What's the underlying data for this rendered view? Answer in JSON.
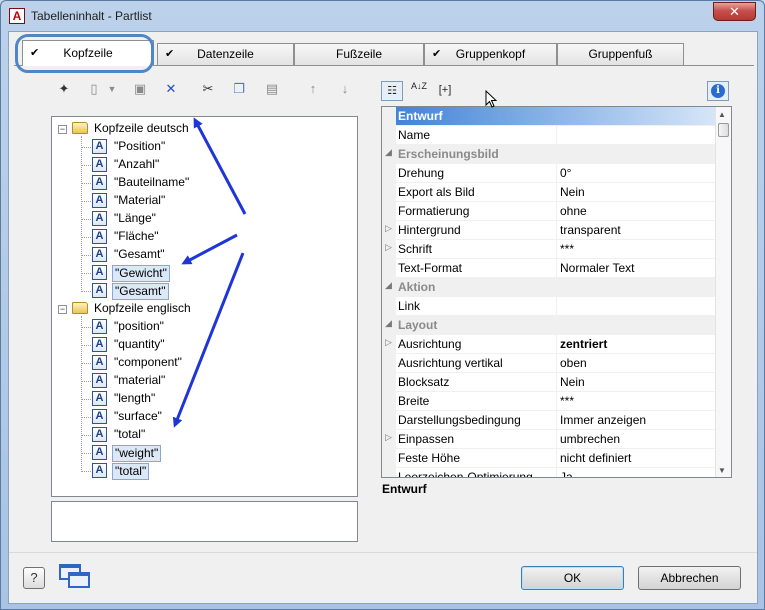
{
  "window": {
    "title": "Tabelleninhalt - Partlist",
    "app_icon_letter": "A",
    "close_glyph": "✕"
  },
  "tabs": [
    {
      "label": "Kopfzeile",
      "checked": true,
      "active": true
    },
    {
      "label": "Datenzeile",
      "checked": true,
      "active": false
    },
    {
      "label": "Fußzeile",
      "checked": false,
      "active": false
    },
    {
      "label": "Gruppenkopf",
      "checked": true,
      "active": false
    },
    {
      "label": "Gruppenfuß",
      "checked": false,
      "active": false
    }
  ],
  "check_glyph": "✔",
  "toolbar_icons": [
    "wand-icon",
    "clipboard-icon",
    "properties-icon",
    "delete-icon",
    "cut-icon",
    "copy-icon",
    "paste-icon",
    "arrow-up-icon",
    "arrow-down-icon"
  ],
  "tree": {
    "groups": [
      {
        "label": "Kopfzeile deutsch",
        "items": [
          {
            "label": "\"Position\"",
            "selected": false
          },
          {
            "label": "\"Anzahl\"",
            "selected": false
          },
          {
            "label": "\"Bauteilname\"",
            "selected": false
          },
          {
            "label": "\"Material\"",
            "selected": false
          },
          {
            "label": "\"Länge\"",
            "selected": false
          },
          {
            "label": "\"Fläche\"",
            "selected": false
          },
          {
            "label": "\"Gesamt\"",
            "selected": false
          },
          {
            "label": "\"Gewicht\"",
            "selected": true
          },
          {
            "label": "\"Gesamt\"",
            "selected": true
          }
        ]
      },
      {
        "label": "Kopfzeile englisch",
        "items": [
          {
            "label": "\"position\"",
            "selected": false
          },
          {
            "label": "\"quantity\"",
            "selected": false
          },
          {
            "label": "\"component\"",
            "selected": false
          },
          {
            "label": "\"material\"",
            "selected": false
          },
          {
            "label": "\"length\"",
            "selected": false
          },
          {
            "label": "\"surface\"",
            "selected": false
          },
          {
            "label": "\"total\"",
            "selected": false
          },
          {
            "label": "\"weight\"",
            "selected": true
          },
          {
            "label": "\"total\"",
            "selected": true
          }
        ]
      }
    ],
    "text_icon_letter": "A"
  },
  "property_toolbar": {
    "categorized_icon": "categorized-icon",
    "sort_label": "A↓Z",
    "expand_label": "[+]",
    "info_glyph": "i"
  },
  "properties": [
    {
      "type": "cat",
      "name": "Entwurf",
      "highlight": true
    },
    {
      "type": "prop",
      "name": "Name",
      "value": ""
    },
    {
      "type": "cat",
      "name": "Erscheinungsbild"
    },
    {
      "type": "prop",
      "name": "Drehung",
      "value": "0°"
    },
    {
      "type": "prop",
      "name": "Export als Bild",
      "value": "Nein"
    },
    {
      "type": "prop",
      "name": "Formatierung",
      "value": "ohne"
    },
    {
      "type": "prop",
      "name": "Hintergrund",
      "value": "transparent",
      "expandable": true
    },
    {
      "type": "prop",
      "name": "Schrift",
      "value": "***",
      "expandable": true
    },
    {
      "type": "prop",
      "name": "Text-Format",
      "value": "Normaler Text"
    },
    {
      "type": "cat",
      "name": "Aktion"
    },
    {
      "type": "prop",
      "name": "Link",
      "value": ""
    },
    {
      "type": "cat",
      "name": "Layout"
    },
    {
      "type": "prop",
      "name": "Ausrichtung",
      "value": "zentriert",
      "expandable": true,
      "bold": true
    },
    {
      "type": "prop",
      "name": "Ausrichtung vertikal",
      "value": "oben"
    },
    {
      "type": "prop",
      "name": "Blocksatz",
      "value": "Nein"
    },
    {
      "type": "prop",
      "name": "Breite",
      "value": "***"
    },
    {
      "type": "prop",
      "name": "Darstellungsbedingung",
      "value": "Immer anzeigen"
    },
    {
      "type": "prop",
      "name": "Einpassen",
      "value": "umbrechen",
      "expandable": true
    },
    {
      "type": "prop",
      "name": "Feste Höhe",
      "value": "nicht definiert"
    },
    {
      "type": "prop",
      "name": "Leerzeichen-Optimierung",
      "value": "Ja"
    }
  ],
  "property_help": {
    "title": "Entwurf"
  },
  "buttons": {
    "help": "?",
    "ok": "OK",
    "cancel": "Abbrechen"
  },
  "colors": {
    "accent": "#4f86c6",
    "annotation_arrow": "#1f35d6",
    "selection": "#dce8f6"
  }
}
